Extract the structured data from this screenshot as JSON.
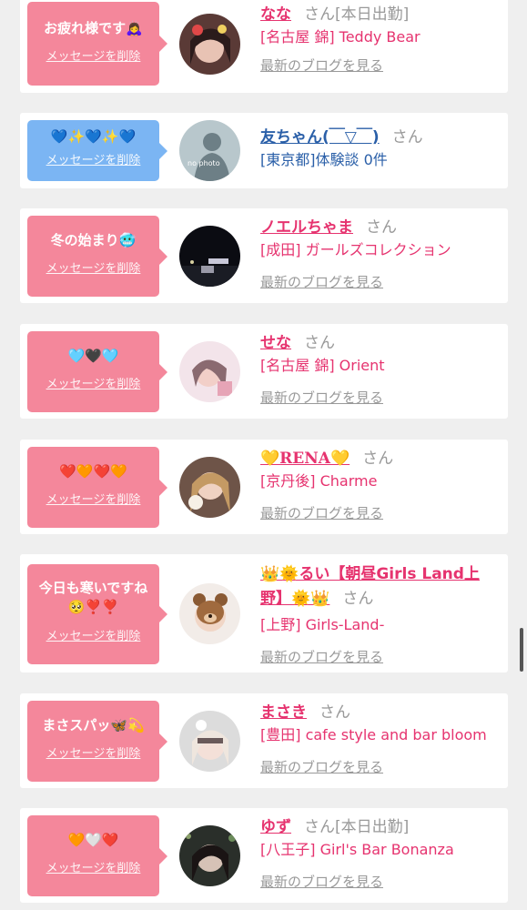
{
  "colors": {
    "pink_bubble": "#f4879b",
    "blue_bubble": "#7bb5f3",
    "name_pink": "#e6336f",
    "name_blue": "#2a5fa8",
    "gray_text": "#999999",
    "background": "#efefef"
  },
  "items": [
    {
      "message": "お疲れ様です🙇‍♀️",
      "delete_label": "メッセージを削除",
      "name": "なな",
      "san": "さん",
      "status": "[本日出勤]",
      "shop": "[名古屋 錦] Teddy Bear",
      "blog_label": "最新のブログを見る",
      "avatar": "girl-photo-avatar"
    },
    {
      "message": "💙✨💙✨💙",
      "delete_label": "メッセージを削除",
      "name": "友ちゃん(￣▽￣)",
      "san": "さん",
      "status": "",
      "shop": "[東京都]体験談 0件",
      "blog_label": "",
      "avatar": "no-photo-avatar",
      "avatar_text": "no photo"
    },
    {
      "message": "冬の始まり🥶",
      "delete_label": "メッセージを削除",
      "name": "ノエルちゃま",
      "san": "さん",
      "status": "",
      "shop": "[成田] ガールズコレクション",
      "blog_label": "最新のブログを見る",
      "avatar": "night-scene-avatar"
    },
    {
      "message": "🩵🖤🩵",
      "delete_label": "メッセージを削除",
      "name": "せな",
      "san": "さん",
      "status": "",
      "shop": "[名古屋 錦] Orient",
      "blog_label": "最新のブログを見る",
      "avatar": "girl-photo-avatar"
    },
    {
      "message": "❤️🧡❤️🧡",
      "delete_label": "メッセージを削除",
      "name": "💛RENA💛",
      "san": "さん",
      "status": "",
      "shop": "[京丹後] Charme",
      "blog_label": "最新のブログを見る",
      "avatar": "girl-photo-avatar"
    },
    {
      "message": "今日も寒いですね\n🥺❣️❣️",
      "delete_label": "メッセージを削除",
      "name": "👑🌞るい【朝昼Girls Land上野】🌞👑",
      "san": "さん",
      "status": "",
      "shop": "[上野] Girls-Land-",
      "blog_label": "最新のブログを見る",
      "avatar": "bear-sticker-avatar"
    },
    {
      "message": "まさスパッ🦋💫",
      "delete_label": "メッセージを削除",
      "name": "まさき",
      "san": "さん",
      "status": "",
      "shop": "[豊田] cafe style and bar bloom",
      "blog_label": "最新のブログを見る",
      "avatar": "girl-photo-avatar"
    },
    {
      "message": "🧡🤍❤️",
      "delete_label": "メッセージを削除",
      "name": "ゆず",
      "san": "さん",
      "status": "[本日出勤]",
      "shop": "[八王子] Girl's Bar Bonanza",
      "blog_label": "最新のブログを見る",
      "avatar": "girl-photo-avatar"
    }
  ]
}
